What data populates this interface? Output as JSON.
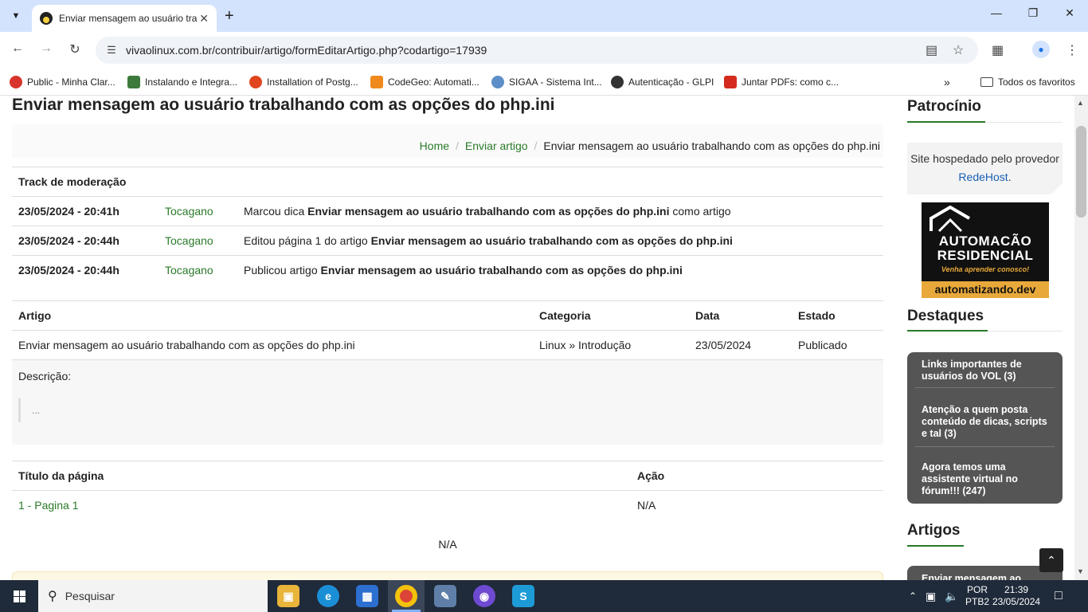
{
  "browser": {
    "tab_title": "Enviar mensagem ao usuário tra",
    "url": "vivaolinux.com.br/contribuir/artigo/formEditarArtigo.php?codartigo=17939",
    "bookmarks": [
      {
        "label": "Public - Minha Clar...",
        "color": "#d9342b"
      },
      {
        "label": "Instalando e Integra...",
        "color": "#3b7a3b"
      },
      {
        "label": "Installation of Postg...",
        "color": "#e0451d"
      },
      {
        "label": "CodeGeo: Automati...",
        "color": "#f08a1c"
      },
      {
        "label": "SIGAA - Sistema Int...",
        "color": "#5c8fc7"
      },
      {
        "label": "Autenticação - GLPI",
        "color": "#333333"
      },
      {
        "label": "Juntar PDFs: como c...",
        "color": "#d42b1e"
      }
    ],
    "all_favorites": "Todos os favoritos"
  },
  "page": {
    "title": "Enviar mensagem ao usuário trabalhando com as opções do php.ini",
    "breadcrumb": {
      "home": "Home",
      "enviar": "Enviar artigo",
      "current": "Enviar mensagem ao usuário trabalhando com as opções do php.ini"
    },
    "moderation": {
      "header": "Track de moderação",
      "rows": [
        {
          "date": "23/05/2024 - 20:41h",
          "user": "Tocagano",
          "pre": "Marcou dica ",
          "bold": "Enviar mensagem ao usuário trabalhando com as opções do php.ini",
          "post": " como artigo"
        },
        {
          "date": "23/05/2024 - 20:44h",
          "user": "Tocagano",
          "pre": "Editou página 1 do artigo ",
          "bold": "Enviar mensagem ao usuário trabalhando com as opções do php.ini",
          "post": ""
        },
        {
          "date": "23/05/2024 - 20:44h",
          "user": "Tocagano",
          "pre": "Publicou artigo ",
          "bold": "Enviar mensagem ao usuário trabalhando com as opções do php.ini",
          "post": ""
        }
      ]
    },
    "article": {
      "headers": {
        "artigo": "Artigo",
        "categoria": "Categoria",
        "data": "Data",
        "estado": "Estado"
      },
      "row": {
        "artigo": "Enviar mensagem ao usuário trabalhando com as opções do php.ini",
        "categoria": "Linux » Introdução",
        "data": "23/05/2024",
        "estado": "Publicado"
      },
      "description_label": "Descrição:",
      "description_text": "..."
    },
    "pages": {
      "headers": {
        "titulo": "Título da página",
        "acao": "Ação"
      },
      "row": {
        "titulo": "1 - Pagina 1",
        "acao": "N/A"
      },
      "footer_na": "N/A"
    }
  },
  "sidebar": {
    "patrocinio": "Patrocínio",
    "sponsor_text": "Site hospedado pelo provedor",
    "sponsor_link": "RedeHost",
    "sponsor_end": ".",
    "ad": {
      "line1": "AUTOMACÃO",
      "line2": "RESIDENCIAL",
      "tagline": "Venha aprender conosco!",
      "site": "automatizando.dev"
    },
    "destaques": "Destaques",
    "destaques_items": [
      "Links importantes de usuários do VOL (3)",
      "Atenção a quem posta conteúdo de dicas, scripts e tal (3)",
      "Agora temos uma assistente virtual no fórum!!! (247)"
    ],
    "artigos": "Artigos",
    "artigos_first": "Enviar mensagem ao"
  },
  "taskbar": {
    "search_placeholder": "Pesquisar",
    "lang": "POR",
    "layout": "PTB2",
    "time": "21:39",
    "date": "23/05/2024"
  }
}
